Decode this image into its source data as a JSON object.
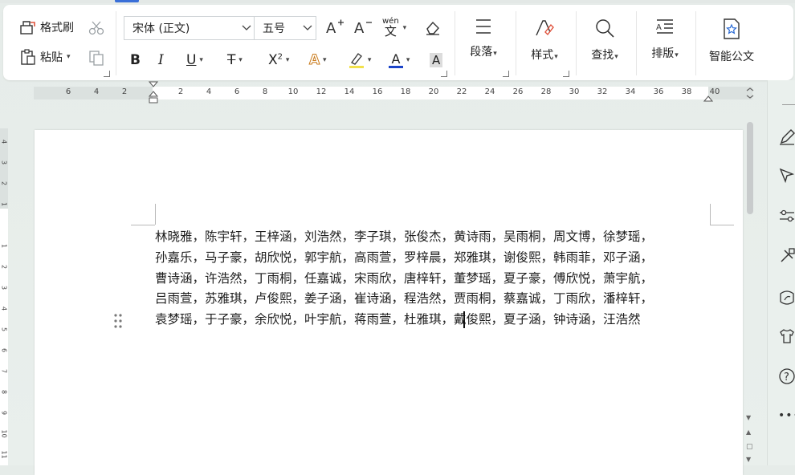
{
  "ribbon": {
    "format_painter": "格式刷",
    "paste": "粘贴",
    "font_name": "宋体 (正文)",
    "font_size": "五号",
    "pinyin_label": "wén",
    "paragraph": "段落",
    "styles": "样式",
    "find": "查找",
    "layout": "排版",
    "smart_doc": "智能公文"
  },
  "ruler": {
    "numbers": [
      "6",
      "4",
      "2",
      "2",
      "4",
      "6",
      "8",
      "10",
      "12",
      "14",
      "16",
      "18",
      "20",
      "22",
      "24",
      "26",
      "28",
      "30",
      "32",
      "34",
      "36",
      "38",
      "40"
    ]
  },
  "vruler": {
    "numbers": [
      "4",
      "3",
      "2",
      "1",
      "1",
      "2",
      "3",
      "4",
      "5",
      "6",
      "7",
      "8",
      "9",
      "10",
      "11"
    ]
  },
  "document": {
    "lines": [
      "林晓雅，陈宇轩，王梓涵，刘浩然，李子琪，张俊杰，黄诗雨，吴雨桐，周文博，徐梦瑶，",
      "孙嘉乐，马子豪，胡欣悦，郭宇航，高雨萱，罗梓晨，郑雅琪，谢俊熙，韩雨菲，邓子涵，",
      "曹诗涵，许浩然，丁雨桐，任嘉诚，宋雨欣，唐梓轩，董梦瑶，夏子豪，傅欣悦，萧宇航，",
      "吕雨萱，苏雅琪，卢俊熙，姜子涵，崔诗涵，程浩然，贾雨桐，蔡嘉诚，丁雨欣，潘梓轩，",
      "袁梦瑶，于子豪，余欣悦，叶宇航，蒋雨萱，杜雅琪，戴俊熙，夏子涵，钟诗涵，汪浩然"
    ]
  }
}
